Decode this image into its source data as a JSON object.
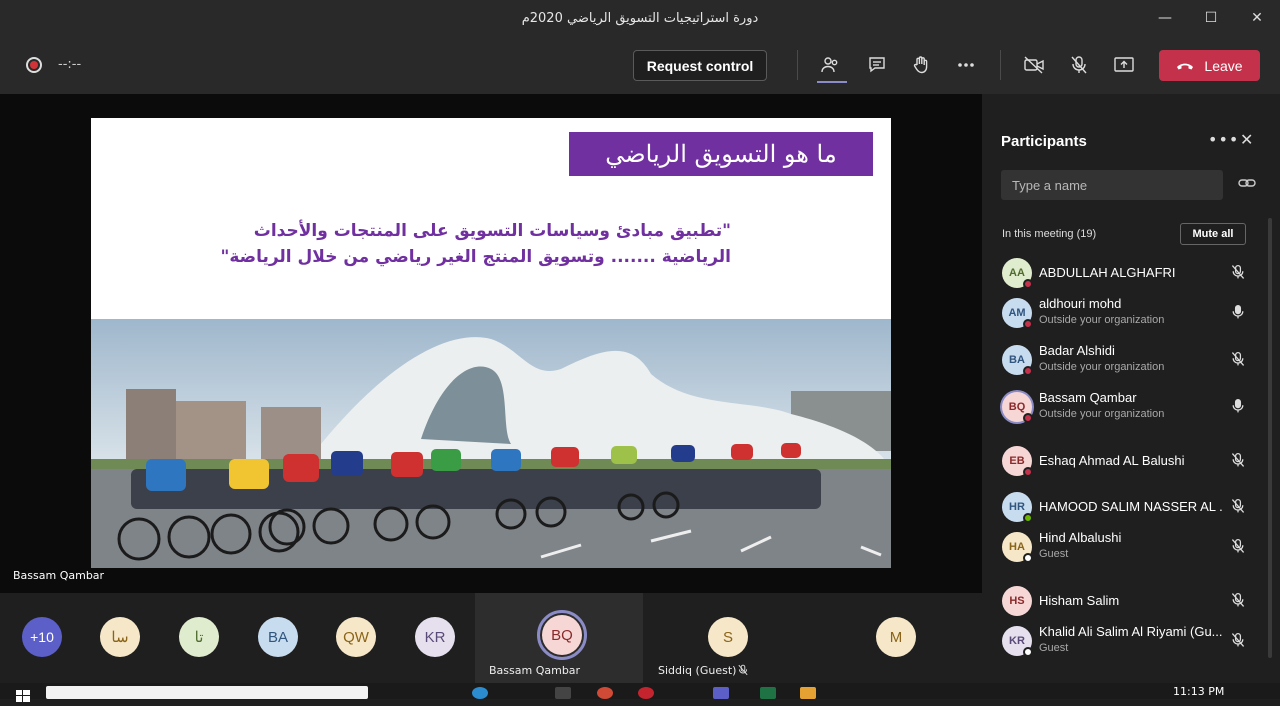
{
  "window": {
    "title": "دورة استراتيجيات التسويق الرياضي 2020م"
  },
  "toolbar": {
    "timer": "--:--",
    "request_control": "Request control",
    "leave": "Leave"
  },
  "slide": {
    "title": "ما هو التسويق الرياضي",
    "line1": "\"تطبيق مبادئ وسياسات التسويق على المنتجات والأحداث",
    "line2": "الرياضية ....... وتسويق المنتج الغير رياضي من خلال الرياضة\""
  },
  "stage": {
    "presenter": "Bassam Qambar"
  },
  "strip": {
    "overflow": "+10",
    "avatars": [
      {
        "initials": "سا",
        "color": "#f6e7c8"
      },
      {
        "initials": "تا",
        "color": "#dfeccd"
      },
      {
        "initials": "BA",
        "color": "#c8dcef"
      },
      {
        "initials": "QW",
        "color": "#f6e7c8"
      },
      {
        "initials": "KR",
        "color": "#e6e0ee"
      }
    ],
    "active": {
      "initials": "BQ",
      "name": "Bassam Qambar"
    },
    "siddiq": {
      "initials": "S",
      "name": "Siddiq (Guest)"
    },
    "m": {
      "initials": "M"
    }
  },
  "panel": {
    "title": "Participants",
    "search_placeholder": "Type a name",
    "in_meeting": "In this meeting (19)",
    "mute_all": "Mute all",
    "participants": [
      {
        "initials": "AA",
        "name": "ABDULLAH ALGHAFRI",
        "sub": "",
        "avatar_color": "#dfeccd",
        "text_color": "#4f6b2d",
        "status": "#c4314b",
        "mic": "muted"
      },
      {
        "initials": "AM",
        "name": "aldhouri mohd",
        "sub": "Outside your organization",
        "avatar_color": "#c8dcef",
        "text_color": "#30557e",
        "status": "#c4314b",
        "mic": "on"
      },
      {
        "initials": "BA",
        "name": "Badar Alshidi",
        "sub": "Outside your organization",
        "avatar_color": "#c8dcef",
        "text_color": "#30557e",
        "status": "#c4314b",
        "mic": "muted"
      },
      {
        "initials": "BQ",
        "name": "Bassam Qambar",
        "sub": "Outside your organization",
        "avatar_color": "#f7d6d6",
        "text_color": "#8a2a2a",
        "status": "#c4314b",
        "mic": "on"
      },
      {
        "initials": "EB",
        "name": "Eshaq Ahmad AL Balushi",
        "sub": "",
        "avatar_color": "#f7d6d6",
        "text_color": "#8a2a2a",
        "status": "#c4314b",
        "mic": "muted"
      },
      {
        "initials": "HR",
        "name": "HAMOOD SALIM NASSER AL ...",
        "sub": "",
        "avatar_color": "#c8dcef",
        "text_color": "#30557e",
        "status": "#6bb700",
        "mic": "muted"
      },
      {
        "initials": "HA",
        "name": "Hind Albalushi",
        "sub": "Guest",
        "avatar_color": "#f6e7c8",
        "text_color": "#8a6418",
        "status": "#ffffff",
        "mic": "muted"
      },
      {
        "initials": "HS",
        "name": "Hisham Salim",
        "sub": "",
        "avatar_color": "#f7d6d6",
        "text_color": "#8a2a2a",
        "status": "",
        "mic": "muted"
      },
      {
        "initials": "KR",
        "name": "Khalid Ali Salim Al Riyami (Gu...",
        "sub": "Guest",
        "avatar_color": "#e6e0ee",
        "text_color": "#5a4a78",
        "status": "#ffffff",
        "mic": "muted"
      }
    ]
  },
  "taskbar": {
    "clock": "11:13 PM"
  },
  "icons": [
    "record-icon",
    "participants-icon",
    "chat-icon",
    "raise-hand-icon",
    "more-icon",
    "camera-off-icon",
    "mic-off-icon",
    "share-icon",
    "phone-icon",
    "link-icon",
    "mic-icon"
  ]
}
